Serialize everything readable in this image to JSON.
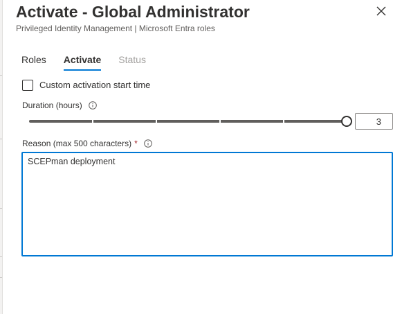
{
  "dialog": {
    "title": "Activate - Global Administrator",
    "subtitle": "Privileged Identity Management | Microsoft Entra roles",
    "close_icon": "close-icon"
  },
  "tabs": [
    {
      "label": "Roles",
      "state": "normal"
    },
    {
      "label": "Activate",
      "state": "selected"
    },
    {
      "label": "Status",
      "state": "disabled"
    }
  ],
  "custom_start": {
    "label": "Custom activation start time",
    "checked": false
  },
  "duration": {
    "label": "Duration (hours)",
    "value": "3",
    "slider_fraction": 1.0,
    "info_icon": "info-icon"
  },
  "reason": {
    "label": "Reason (max 500 characters)",
    "required_mark": "*",
    "value": "SCEPman deployment",
    "info_icon": "info-icon"
  },
  "colors": {
    "accent": "#0078d4",
    "required": "#a4262c",
    "disabled_text": "#a19f9d"
  }
}
